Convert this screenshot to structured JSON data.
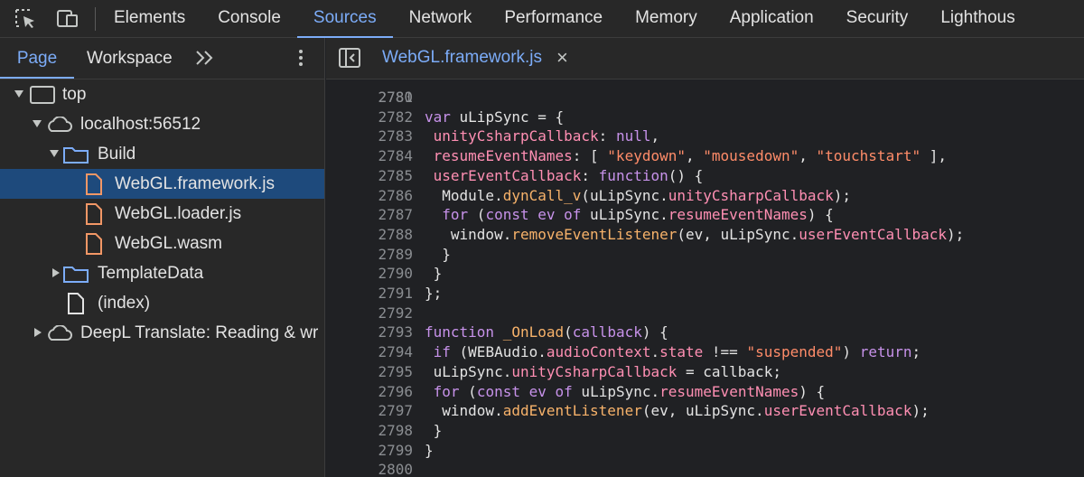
{
  "topbar": {
    "tabs": [
      {
        "label": "Elements",
        "active": false
      },
      {
        "label": "Console",
        "active": false
      },
      {
        "label": "Sources",
        "active": true
      },
      {
        "label": "Network",
        "active": false
      },
      {
        "label": "Performance",
        "active": false
      },
      {
        "label": "Memory",
        "active": false
      },
      {
        "label": "Application",
        "active": false
      },
      {
        "label": "Security",
        "active": false
      },
      {
        "label": "Lighthous",
        "active": false
      }
    ],
    "icons": [
      "inspect-element-icon",
      "device-toolbar-icon"
    ]
  },
  "navigator": {
    "tabs": [
      {
        "label": "Page",
        "active": true
      },
      {
        "label": "Workspace",
        "active": false
      }
    ],
    "more_icon": "chevron-double-right-icon",
    "menu_icon": "kebab-menu-icon",
    "tree": [
      {
        "label": "top",
        "icon": "frame-icon",
        "expanded": true,
        "selected": false
      },
      {
        "label": "localhost:56512",
        "icon": "cloud-icon",
        "expanded": true,
        "selected": false
      },
      {
        "label": "Build",
        "icon": "folder-icon",
        "expanded": true,
        "selected": false
      },
      {
        "label": "WebGL.framework.js",
        "icon": "file-icon",
        "selected": true
      },
      {
        "label": "WebGL.loader.js",
        "icon": "file-icon",
        "selected": false
      },
      {
        "label": "WebGL.wasm",
        "icon": "file-icon",
        "selected": false
      },
      {
        "label": "TemplateData",
        "icon": "folder-icon",
        "expanded": false,
        "selected": false
      },
      {
        "label": "(index)",
        "icon": "document-icon",
        "selected": false
      },
      {
        "label": "DeepL Translate: Reading & wr",
        "icon": "cloud-icon",
        "expanded": false,
        "selected": false
      }
    ]
  },
  "editor": {
    "toggle_icon": "toggle-navigator-icon",
    "open_file": "WebGL.framework.js",
    "close_symbol": "×",
    "partial_line_number": "2780",
    "lines": [
      {
        "n": "2781",
        "tokens": []
      },
      {
        "n": "2782",
        "tokens": [
          [
            "kw",
            "var"
          ],
          [
            "plain",
            " uLipSync = {"
          ]
        ]
      },
      {
        "n": "2783",
        "tokens": [
          [
            "plain",
            " "
          ],
          [
            "prop",
            "unityCsharpCallback"
          ],
          [
            "plain",
            ": "
          ],
          [
            "kw",
            "null"
          ],
          [
            "plain",
            ","
          ]
        ]
      },
      {
        "n": "2784",
        "tokens": [
          [
            "plain",
            " "
          ],
          [
            "prop",
            "resumeEventNames"
          ],
          [
            "plain",
            ": [ "
          ],
          [
            "str",
            "\"keydown\""
          ],
          [
            "plain",
            ", "
          ],
          [
            "str",
            "\"mousedown\""
          ],
          [
            "plain",
            ", "
          ],
          [
            "str",
            "\"touchstart\""
          ],
          [
            "plain",
            " ],"
          ]
        ]
      },
      {
        "n": "2785",
        "tokens": [
          [
            "plain",
            " "
          ],
          [
            "prop",
            "userEventCallback"
          ],
          [
            "plain",
            ": "
          ],
          [
            "kw",
            "function"
          ],
          [
            "plain",
            "() {"
          ]
        ]
      },
      {
        "n": "2786",
        "tokens": [
          [
            "plain",
            "  Module."
          ],
          [
            "fn",
            "dynCall_v"
          ],
          [
            "plain",
            "(uLipSync."
          ],
          [
            "prop",
            "unityCsharpCallback"
          ],
          [
            "plain",
            ");"
          ]
        ]
      },
      {
        "n": "2787",
        "tokens": [
          [
            "plain",
            "  "
          ],
          [
            "kw",
            "for"
          ],
          [
            "plain",
            " ("
          ],
          [
            "kw",
            "const"
          ],
          [
            "plain",
            " "
          ],
          [
            "kw",
            "ev"
          ],
          [
            "plain",
            " "
          ],
          [
            "kw",
            "of"
          ],
          [
            "plain",
            " uLipSync."
          ],
          [
            "prop",
            "resumeEventNames"
          ],
          [
            "plain",
            ") {"
          ]
        ]
      },
      {
        "n": "2788",
        "tokens": [
          [
            "plain",
            "   window."
          ],
          [
            "fn",
            "removeEventListener"
          ],
          [
            "plain",
            "(ev, uLipSync."
          ],
          [
            "prop",
            "userEventCallback"
          ],
          [
            "plain",
            ");"
          ]
        ]
      },
      {
        "n": "2789",
        "tokens": [
          [
            "plain",
            "  }"
          ]
        ]
      },
      {
        "n": "2790",
        "tokens": [
          [
            "plain",
            " }"
          ]
        ]
      },
      {
        "n": "2791",
        "tokens": [
          [
            "plain",
            "};"
          ]
        ]
      },
      {
        "n": "2792",
        "tokens": []
      },
      {
        "n": "2793",
        "tokens": [
          [
            "kw",
            "function"
          ],
          [
            "plain",
            " "
          ],
          [
            "fn",
            "_OnLoad"
          ],
          [
            "plain",
            "("
          ],
          [
            "kw",
            "callback"
          ],
          [
            "plain",
            ") {"
          ]
        ]
      },
      {
        "n": "2794",
        "tokens": [
          [
            "plain",
            " "
          ],
          [
            "kw",
            "if"
          ],
          [
            "plain",
            " (WEBAudio."
          ],
          [
            "prop",
            "audioContext"
          ],
          [
            "plain",
            "."
          ],
          [
            "prop",
            "state"
          ],
          [
            "plain",
            " !== "
          ],
          [
            "str",
            "\"suspended\""
          ],
          [
            "plain",
            ") "
          ],
          [
            "kw",
            "return"
          ],
          [
            "plain",
            ";"
          ]
        ]
      },
      {
        "n": "2795",
        "tokens": [
          [
            "plain",
            " uLipSync."
          ],
          [
            "prop",
            "unityCsharpCallback"
          ],
          [
            "plain",
            " = callback;"
          ]
        ]
      },
      {
        "n": "2796",
        "tokens": [
          [
            "plain",
            " "
          ],
          [
            "kw",
            "for"
          ],
          [
            "plain",
            " ("
          ],
          [
            "kw",
            "const"
          ],
          [
            "plain",
            " "
          ],
          [
            "kw",
            "ev"
          ],
          [
            "plain",
            " "
          ],
          [
            "kw",
            "of"
          ],
          [
            "plain",
            " uLipSync."
          ],
          [
            "prop",
            "resumeEventNames"
          ],
          [
            "plain",
            ") {"
          ]
        ]
      },
      {
        "n": "2797",
        "tokens": [
          [
            "plain",
            "  window."
          ],
          [
            "fn",
            "addEventListener"
          ],
          [
            "plain",
            "(ev, uLipSync."
          ],
          [
            "prop",
            "userEventCallback"
          ],
          [
            "plain",
            ");"
          ]
        ]
      },
      {
        "n": "2798",
        "tokens": [
          [
            "plain",
            " }"
          ]
        ]
      },
      {
        "n": "2799",
        "tokens": [
          [
            "plain",
            "}"
          ]
        ]
      },
      {
        "n": "2800",
        "tokens": []
      }
    ]
  },
  "colors": {
    "accent": "#7cacf8",
    "selection": "#1e4a7c",
    "file_icon": "#f29766",
    "folder_icon": "#7cacf8"
  }
}
